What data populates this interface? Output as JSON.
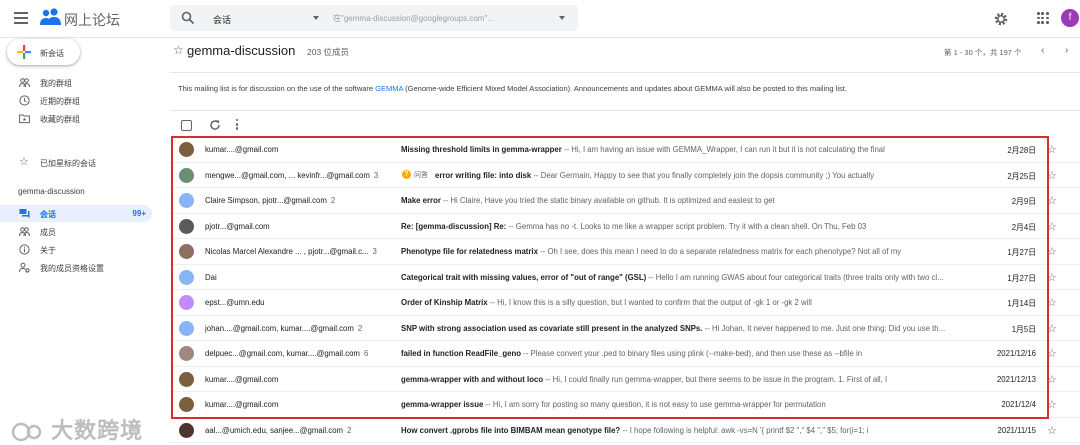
{
  "app": {
    "title": "网上论坛"
  },
  "search": {
    "query": "会话",
    "placeholder": "在\"gemma-discussion@googlegroups.com\"..."
  },
  "user": {
    "initial": "f"
  },
  "sidebar": {
    "new_conversation": "新会话",
    "items": [
      {
        "label": "我的群组",
        "icon": "groups-icon"
      },
      {
        "label": "近期的群组",
        "icon": "clock-icon"
      },
      {
        "label": "收藏的群组",
        "icon": "folder-star-icon"
      },
      {
        "label": "已加星标的会话",
        "icon": "star-icon"
      }
    ],
    "section": "gemma-discussion",
    "group_items": [
      {
        "label": "会话",
        "icon": "conversation-icon",
        "count": "99+"
      },
      {
        "label": "成员",
        "icon": "members-icon"
      },
      {
        "label": "关于",
        "icon": "info-icon"
      },
      {
        "label": "我的成员资格设置",
        "icon": "settings-person-icon"
      }
    ]
  },
  "group": {
    "name": "gemma-discussion",
    "members": "203 位成员",
    "paging": "第 1 - 30 个，共 197 个",
    "description_pre": "This mailing list is for discussion on the use of the software ",
    "description_link": "GEMMA",
    "description_post": " (Genome-wide Efficient Mixed Model Association). Announcements and updates about GEMMA will also be posted to this mailing list."
  },
  "threads": [
    {
      "from": "kumar....@gmail.com",
      "count": "",
      "tag": "",
      "subject": "Missing threshold limits in gemma-wrapper",
      "snippet": " -- Hi, I am having an issue with GEMMA_Wrapper, I can run it but it is not calculating the final",
      "date": "2月28日",
      "avatar": "#7b5e3d"
    },
    {
      "from": "mengwe...@gmail.com, ... kevinfr...@gmail.com",
      "count": "3",
      "tag": "问答",
      "subject": "error writing file: into disk",
      "snippet": " -- Dear Germain, Happy to see that you finally completely join the dopsis community ;) You actually",
      "date": "2月25日",
      "avatar": "#6b8f71"
    },
    {
      "from": "Claire Simpson, pjotr...@gmail.com",
      "count": "2",
      "tag": "",
      "subject": "Make error",
      "snippet": " -- Hi Claire, Have you tried the static binary available on github. It is optimized and easiest to get",
      "date": "2月9日",
      "avatar": "#8ab4f8"
    },
    {
      "from": "pjotr...@gmail.com",
      "count": "",
      "tag": "",
      "subject": "Re: [gemma-discussion] Re:",
      "snippet": " -- Gemma has no -t. Looks to me like a wrapper script problem. Try it with a clean shell. On Thu, Feb 03",
      "date": "2月4日",
      "avatar": "#5a5a5a"
    },
    {
      "from": "Nicolas Marcel Alexandre ... , pjotr...@gmail.c...",
      "count": "3",
      "tag": "",
      "subject": "Phenotype file for relatedness matrix",
      "snippet": " -- Oh I see, does this mean I need to do a separate relatedness matrix for each phenotype? Not all of my",
      "date": "1月27日",
      "avatar": "#8d6e63"
    },
    {
      "from": "Dai",
      "count": "",
      "tag": "",
      "subject": "Categorical trait with missing values, error of \"out of range\" (GSL)",
      "snippet": " -- Hello I am running GWAS about four categorical traits (three traits only with two cl...",
      "date": "1月27日",
      "avatar": "#8ab4f8"
    },
    {
      "from": "epst...@umn.edu",
      "count": "",
      "tag": "",
      "subject": "Order of Kinship Matrix",
      "snippet": " -- Hi, I know this is a silly question, but I wanted to confirm that the output of -gk 1 or -gk 2 will",
      "date": "1月14日",
      "avatar": "#c58af9"
    },
    {
      "from": "johan....@gmail.com, kumar....@gmail.com",
      "count": "2",
      "tag": "",
      "subject": "SNP with strong association used as covariate still present in the analyzed SNPs.",
      "snippet": " -- Hi Johan, It never happened to me. Just one thing: Did you use th...",
      "date": "1月5日",
      "avatar": "#8ab4f8"
    },
    {
      "from": "delpuec...@gmail.com, kumar....@gmail.com",
      "count": "6",
      "tag": "",
      "subject": "failed in function ReadFile_geno",
      "snippet": " -- Please convert your .ped to binary files using plink (--make-bed), and then use these as --bfile in",
      "date": "2021/12/16",
      "avatar": "#a1887f"
    },
    {
      "from": "kumar....@gmail.com",
      "count": "",
      "tag": "",
      "subject": "gemma-wrapper with and without loco",
      "snippet": " -- Hi, I could finally run gemma-wrapper, but there seems to be issue in the program. 1. First of all, I",
      "date": "2021/12/13",
      "avatar": "#7b5e3d"
    },
    {
      "from": "kumar....@gmail.com",
      "count": "",
      "tag": "",
      "subject": "gemma-wrapper issue",
      "snippet": " -- Hi, I am sorry for posting so many question, it is not easy to use gemma-wrapper for permutation",
      "date": "2021/12/4",
      "avatar": "#7b5e3d"
    },
    {
      "from": "aal...@umich.edu, sanjee...@gmail.com",
      "count": "2",
      "tag": "",
      "subject": "How convert .gprobs file into BIMBAM mean genotype file?",
      "snippet": " -- I hope following is helpful: awk -vs=N '{ printf $2 \",\" $4 \",\" $5; for(i=1; i",
      "date": "2021/11/15",
      "avatar": "#4e342e"
    }
  ],
  "watermark": "大数跨境",
  "colors": {
    "accent": "#1a73e8",
    "highlight": "#d32f2f"
  }
}
